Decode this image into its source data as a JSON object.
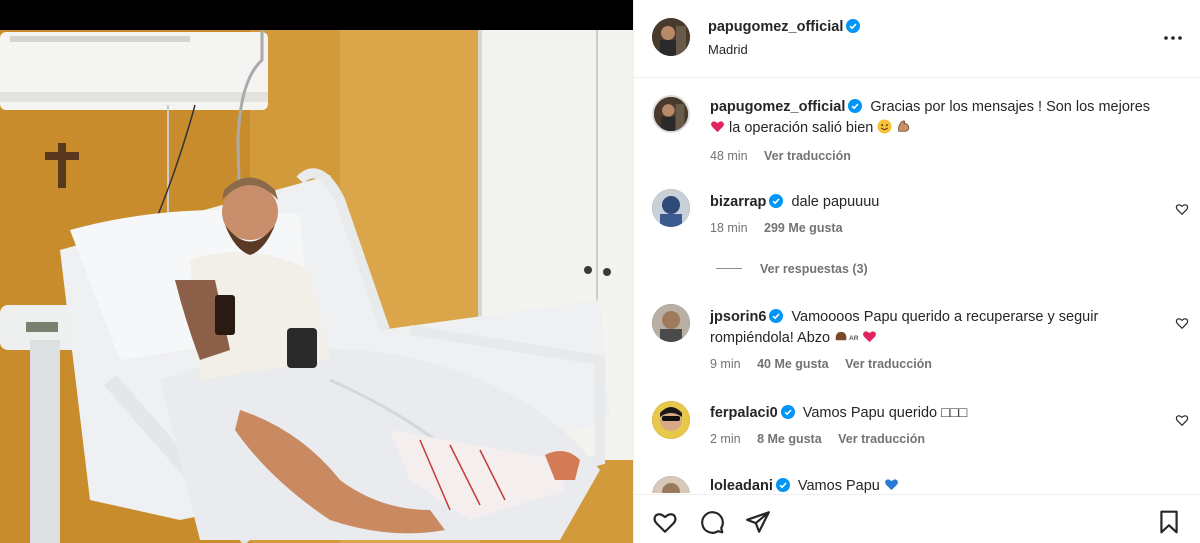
{
  "post": {
    "username": "papugomez_official",
    "location": "Madrid"
  },
  "caption": {
    "username": "papugomez_official",
    "text_part1": "Gracias por los mensajes ! Son los mejores",
    "text_part2": "la operación salió bien",
    "time": "48 min",
    "translate": "Ver traducción"
  },
  "comments": [
    {
      "username": "bizarrap",
      "text": "dale papuuuu",
      "time": "18 min",
      "likes": "299 Me gusta",
      "replies": "Ver respuestas (3)"
    },
    {
      "username": "jpsorin6",
      "text": "Vamoooos Papu querido a recuperarse y seguir rompiéndola! Abzo",
      "flag_text": "AR",
      "time": "9 min",
      "likes": "40 Me gusta",
      "translate": "Ver traducción"
    },
    {
      "username": "ferpalaci0",
      "text": "Vamos Papu querido □□□",
      "time": "2 min",
      "likes": "8 Me gusta",
      "translate": "Ver traducción"
    },
    {
      "username": "loleadani",
      "text": "Vamos Papu"
    }
  ],
  "icons": {
    "verified": "verified-badge-icon",
    "more": "more-options-icon",
    "like": "heart-icon",
    "comment": "comment-bubble-icon",
    "share": "paper-plane-icon",
    "save": "bookmark-icon"
  },
  "colors": {
    "verified": "#0095f6",
    "secondary_text": "#737373",
    "border": "#efefef",
    "heart_red": "#e0245e"
  }
}
